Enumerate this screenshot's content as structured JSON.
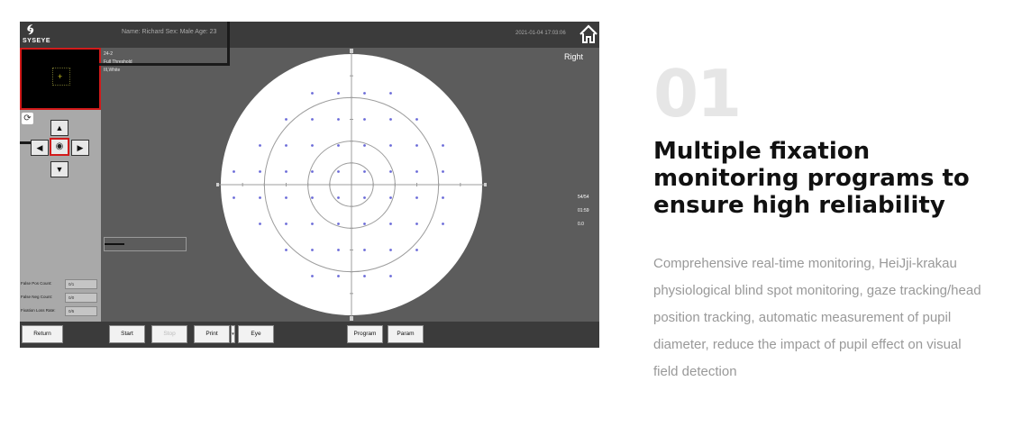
{
  "screen": {
    "logo_text": "SYSEYE",
    "patient_info": "Name: Richard   Sex: Male   Age: 23",
    "datetime": "2021-01-04 17:03:06",
    "test_info": [
      "24-2",
      "Full Threshold",
      "III,White"
    ],
    "eye": "Right",
    "counts": [
      "54/54",
      "01:59",
      "0.0"
    ],
    "progress": 0.24,
    "stats": [
      {
        "label": "False Pos Count:",
        "value": "0/1"
      },
      {
        "label": "False Neg Count:",
        "value": "0/0"
      },
      {
        "label": "Fixation Loss Rate:",
        "value": "0/5"
      }
    ],
    "toolbar": {
      "return": "Return",
      "start": "Start",
      "stop": "Stop",
      "print": "Print",
      "eye": "Eye",
      "program": "Program",
      "param": "Param"
    },
    "icons": {
      "home": "home-icon",
      "refresh": "refresh-icon",
      "up": "arrow-up-icon",
      "down": "arrow-down-icon",
      "left": "arrow-left-icon",
      "right": "arrow-right-icon",
      "eye": "eye-icon"
    }
  },
  "chart_data": {
    "type": "scatter",
    "title": "",
    "xlabel": "",
    "ylabel": "",
    "xlim": [
      -30,
      30
    ],
    "ylim": [
      -30,
      30
    ],
    "rings": [
      10,
      20,
      30
    ],
    "series": [
      {
        "points": [
          [
            -9,
            21
          ],
          [
            -3,
            21
          ],
          [
            3,
            21
          ],
          [
            9,
            21
          ],
          [
            -15,
            15
          ],
          [
            -9,
            15
          ],
          [
            -3,
            15
          ],
          [
            3,
            15
          ],
          [
            9,
            15
          ],
          [
            15,
            15
          ],
          [
            -21,
            9
          ],
          [
            -15,
            9
          ],
          [
            -9,
            9
          ],
          [
            -3,
            9
          ],
          [
            3,
            9
          ],
          [
            9,
            9
          ],
          [
            15,
            9
          ],
          [
            21,
            9
          ],
          [
            -27,
            3
          ],
          [
            -21,
            3
          ],
          [
            -15,
            3
          ],
          [
            -9,
            3
          ],
          [
            -3,
            3
          ],
          [
            3,
            3
          ],
          [
            9,
            3
          ],
          [
            15,
            3
          ],
          [
            21,
            3
          ],
          [
            -27,
            -3
          ],
          [
            -21,
            -3
          ],
          [
            -15,
            -3
          ],
          [
            -9,
            -3
          ],
          [
            -3,
            -3
          ],
          [
            3,
            -3
          ],
          [
            9,
            -3
          ],
          [
            15,
            -3
          ],
          [
            21,
            -3
          ],
          [
            -21,
            -9
          ],
          [
            -15,
            -9
          ],
          [
            -9,
            -9
          ],
          [
            -3,
            -9
          ],
          [
            3,
            -9
          ],
          [
            9,
            -9
          ],
          [
            15,
            -9
          ],
          [
            21,
            -9
          ],
          [
            -15,
            -15
          ],
          [
            -9,
            -15
          ],
          [
            -3,
            -15
          ],
          [
            3,
            -15
          ],
          [
            9,
            -15
          ],
          [
            15,
            -15
          ],
          [
            -9,
            -21
          ],
          [
            -3,
            -21
          ],
          [
            3,
            -21
          ],
          [
            9,
            -21
          ]
        ]
      }
    ]
  },
  "article": {
    "number": "01",
    "title": "Multiple fixation monitoring programs to ensure high reliability",
    "description": "Comprehensive real-time monitoring, HeiJji-krakau physiological blind spot monitoring, gaze tracking/head position tracking, automatic measurement of pupil diameter, reduce the impact of pupil effect on visual field detection"
  }
}
